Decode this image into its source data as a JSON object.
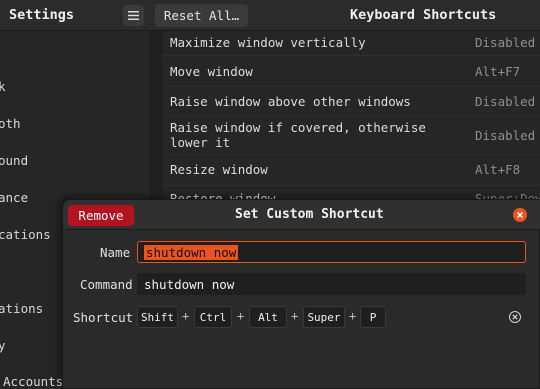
{
  "header": {
    "app_title": "Settings",
    "reset_label": "Reset All…",
    "panel_title": "Keyboard Shortcuts"
  },
  "sidebar": {
    "items": [
      {
        "label": "k"
      },
      {
        "label": "oth"
      },
      {
        "label": "ound"
      },
      {
        "label": "ance"
      },
      {
        "label": "cations"
      },
      {
        "label": "ations"
      },
      {
        "label": "y"
      },
      {
        "label": "Accounts"
      }
    ]
  },
  "shortcuts": [
    {
      "label": "Maximize window vertically",
      "value": "Disabled"
    },
    {
      "label": "Move window",
      "value": "Alt+F7"
    },
    {
      "label": "Raise window above other windows",
      "value": "Disabled"
    },
    {
      "label": "Raise window if covered, otherwise lower it",
      "value": "Disabled"
    },
    {
      "label": "Resize window",
      "value": "Alt+F8"
    },
    {
      "label": "Restore window",
      "value": "Super+Down"
    }
  ],
  "dialog": {
    "title": "Set Custom Shortcut",
    "remove_label": "Remove",
    "name_label": "Name",
    "name_value": "shutdown now",
    "command_label": "Command",
    "command_value": "shutdown now",
    "shortcut_label": "Shortcut",
    "keys": [
      "Shift",
      "Ctrl",
      "Alt",
      "Super",
      "P"
    ],
    "plus": "+"
  },
  "colors": {
    "accent": "#e95420",
    "destructive": "#b4121f"
  }
}
